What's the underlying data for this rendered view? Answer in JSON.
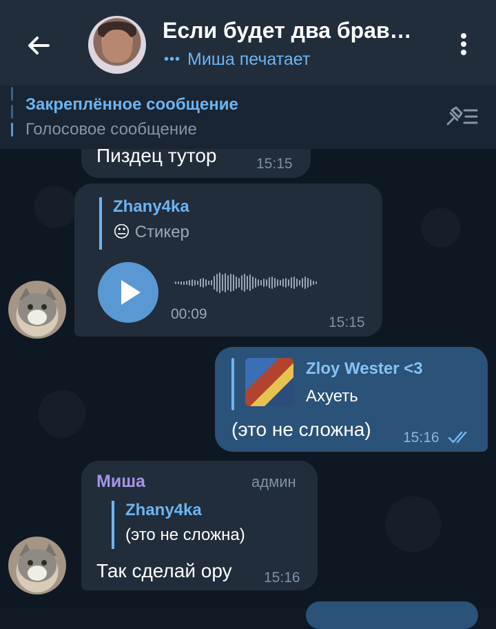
{
  "header": {
    "title": "Если будет два брав…",
    "typing_dots": "•••",
    "status": "Миша печатает"
  },
  "pinned": {
    "title": "Закреплённое сообщение",
    "subtitle": "Голосовое сообщение"
  },
  "messages": [
    {
      "text": "Пиздец тутор",
      "time": "15:15"
    },
    {
      "reply_name": "Zhany4ka",
      "reply_emoji": "😐",
      "reply_text": "Стикер",
      "voice_duration": "00:09",
      "time": "15:15"
    },
    {
      "reply_name": "Zloy Wester <3",
      "reply_text": "Ахуеть",
      "text": "(это не сложна)",
      "time": "15:16"
    },
    {
      "sender": "Миша",
      "role": "админ",
      "reply_name": "Zhany4ka",
      "reply_text": "(это не сложна)",
      "text": "Так сделай ору",
      "time": "15:16"
    }
  ],
  "colors": {
    "header_bg": "#212d3b",
    "accent": "#6db4f2",
    "bubble_in": "#212d3b",
    "bubble_out": "#2b5278",
    "sender": "#a695e7"
  }
}
